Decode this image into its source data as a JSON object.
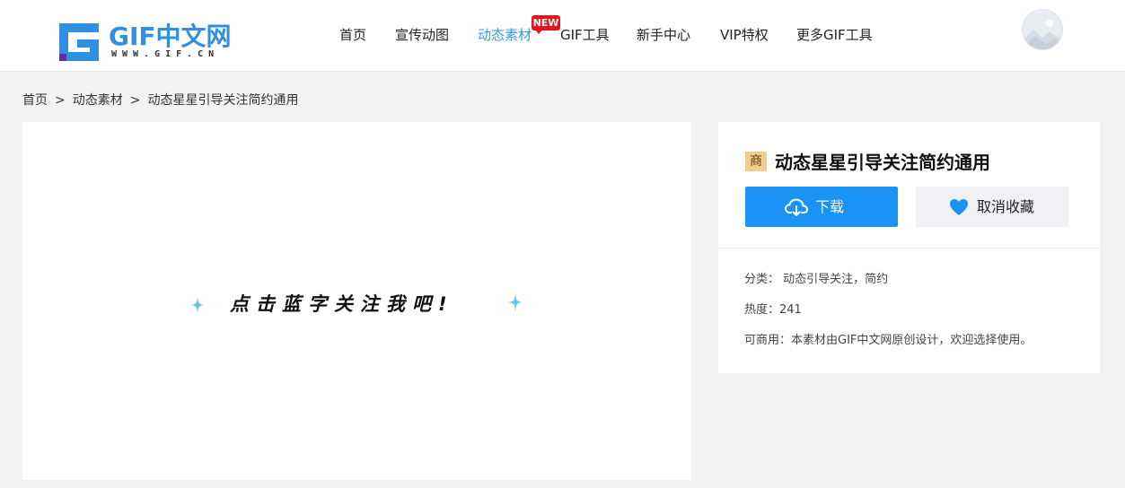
{
  "header": {
    "logo_text": "GIF中文网",
    "logo_url": "WWW.GIF.CN",
    "nav": [
      {
        "label": "首页",
        "active": false
      },
      {
        "label": "宣传动图",
        "active": false
      },
      {
        "label": "动态素材",
        "active": true
      },
      {
        "label": "GIF工具",
        "active": false
      },
      {
        "label": "新手中心",
        "active": false
      },
      {
        "label": "VIP特权",
        "active": false
      },
      {
        "label": "更多GIF工具",
        "active": false
      }
    ],
    "new_badge": "NEW",
    "avatar_icon": "user-avatar-icon"
  },
  "breadcrumb": {
    "items": [
      "首页",
      "动态素材",
      "动态星星引导关注简约通用"
    ],
    "separator": ">"
  },
  "preview": {
    "text": "点击蓝字关注我吧!",
    "sparkle_color": "#5cc7f2"
  },
  "detail": {
    "badge": "商",
    "title": "动态星星引导关注简约通用",
    "download_label": "下载",
    "favorite_label": "取消收藏",
    "category_label": "分类：",
    "category_value": "动态引导关注，简约",
    "heat_label": "热度：",
    "heat_value": "241",
    "commercial_label": "可商用：",
    "commercial_value": "本素材由GIF中文网原创设计，欢迎选择使用。"
  },
  "colors": {
    "accent": "#1a93f6",
    "nav_active": "#2f9be4",
    "badge_new": "#e7141a",
    "badge_shang": "#f1cd8e"
  }
}
